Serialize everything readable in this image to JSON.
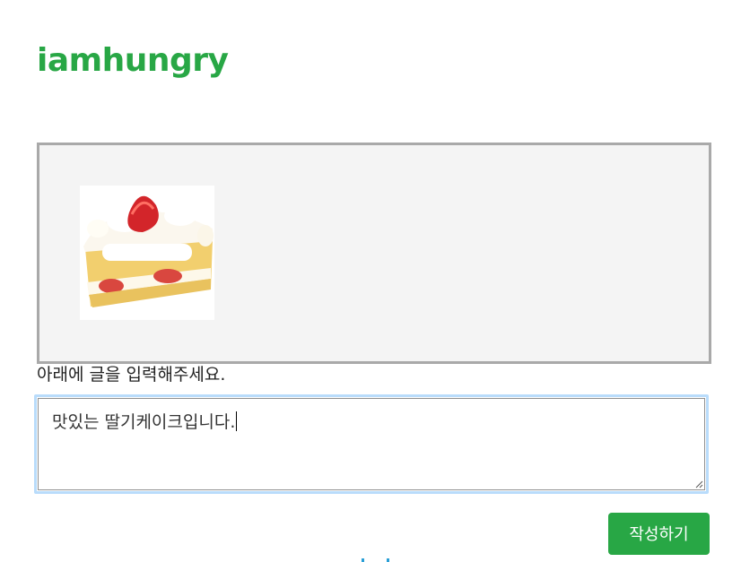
{
  "header": {
    "brand": "iamhungry"
  },
  "upload": {
    "image_alt": "strawberry shortcake slice"
  },
  "form": {
    "prompt_label": "아래에 글을 입력해주세요.",
    "textarea_value": "맛있는 딸기케이크입니다.",
    "submit_label": "작성하기"
  },
  "colors": {
    "brand": "#28a745",
    "button": "#28a745",
    "focus_ring": "#b9dcfb",
    "dropzone_bg": "#f4f4f4"
  }
}
